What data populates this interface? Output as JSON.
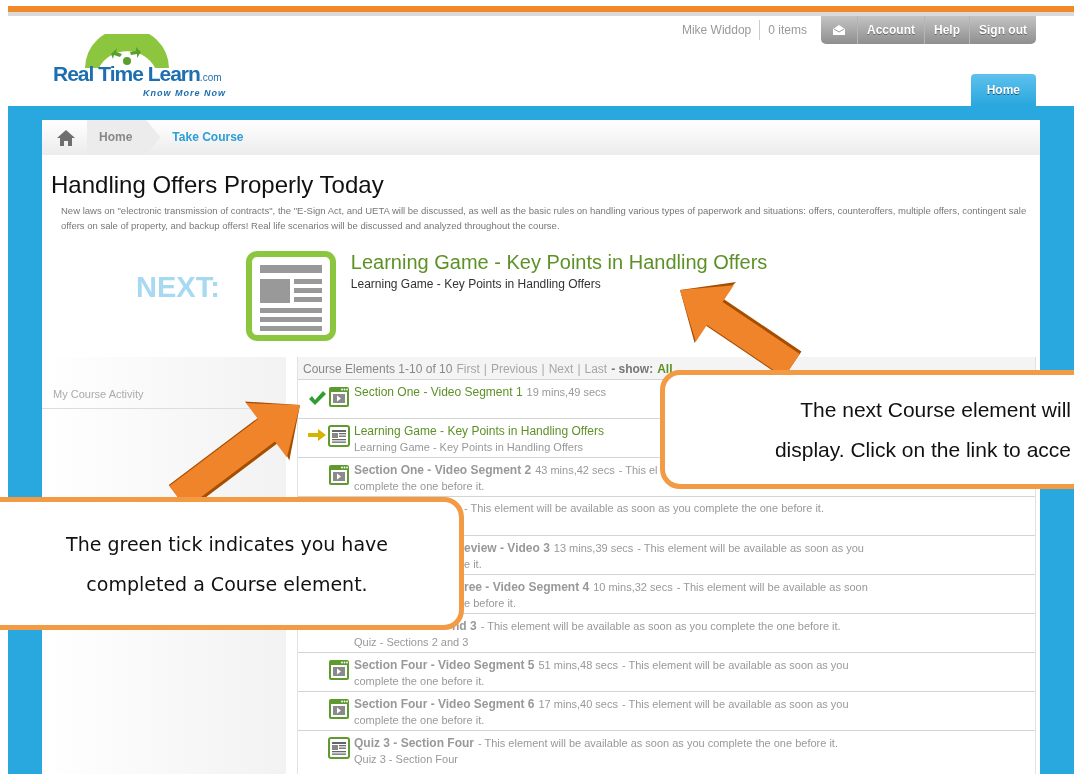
{
  "logo": {
    "name": "Real Time Learn",
    "suffix": ".com",
    "tagline": "Know More Now"
  },
  "user": {
    "name": "Mike Widdop",
    "cart": "0 items"
  },
  "account_menu": [
    "Account",
    "Help",
    "Sign out"
  ],
  "nav_tabs": [
    {
      "label": "Home",
      "selected": true
    }
  ],
  "breadcrumb": [
    "Home",
    "Take Course"
  ],
  "course": {
    "title": "Handling Offers Properly Today",
    "description": "New laws on \"electronic transmission of contracts\", the \"E-Sign Act, and UETA will be discussed, as well as the basic rules on handling various types of paperwork and situations: offers, counteroffers, multiple offers, contingent sale offers on sale of property, and backup offers! Real life scenarios will be discussed and analyzed throughout the course."
  },
  "next": {
    "label": "NEXT:",
    "title": "Learning Game - Key Points in Handling Offers",
    "subtitle": "Learning Game - Key Points in Handling Offers"
  },
  "sidebar": {
    "title": "My Course Activity"
  },
  "elements": {
    "summary": "Course Elements 1-10 of 10",
    "separator": "|",
    "pager": [
      {
        "label": "First",
        "disabled": true
      },
      {
        "label": "Previous",
        "disabled": true
      },
      {
        "label": "Next",
        "disabled": true
      },
      {
        "label": "Last",
        "disabled": true
      }
    ],
    "show_label": "- show:",
    "show_value": "All",
    "rows": [
      {
        "kind": "video",
        "completed": true,
        "current": false,
        "title": "Section One - Video Segment 1",
        "duration": "19 mins,49 secs"
      },
      {
        "kind": "document",
        "completed": false,
        "current": true,
        "title": "Learning Game - Key Points in Handling Offers",
        "line2": "Learning Game - Key Points in Handling Offers"
      },
      {
        "kind": "video",
        "completed": false,
        "current": false,
        "title": "Section One - Video Segment 2",
        "duration": "43 mins,42 secs",
        "note": "- This el",
        "line2": "complete the one before it."
      },
      {
        "kind": "covered",
        "note": "- This element will be available as soon as you complete the one before it."
      },
      {
        "kind": "covered",
        "title": "eview - Video 3",
        "duration": "13 mins,39 secs",
        "note": "- This element will be available as soon as you",
        "line2": "e it."
      },
      {
        "kind": "covered",
        "title": "ree - Video Segment 4",
        "duration": "10 mins,32 secs",
        "note": "- This element will be available as soon",
        "line2": "e before it."
      },
      {
        "kind": "covered-top",
        "title": "nd 3",
        "note": "- This element will be available as soon as you complete the one before it.",
        "line2": "Quiz - Sections 2 and 3"
      },
      {
        "kind": "video",
        "completed": false,
        "current": false,
        "title": "Section Four - Video Segment 5",
        "duration": "51 mins,48 secs",
        "note": "- This element will be available as soon as you",
        "line2": "complete the one before it."
      },
      {
        "kind": "video",
        "completed": false,
        "current": false,
        "title": "Section Four - Video Segment 6",
        "duration": "17 mins,40 secs",
        "note": "- This element will be available as soon as you",
        "line2": "complete the one before it."
      },
      {
        "kind": "document",
        "completed": false,
        "current": false,
        "title": "Quiz 3 - Section Four",
        "note": "- This element will be available as soon as you complete the one before it.",
        "line2": "Quiz 3 - Section Four"
      }
    ]
  },
  "callouts": [
    {
      "lines": [
        "The green tick indicates you have",
        "completed a Course element."
      ]
    },
    {
      "lines": [
        "The next Course element will",
        "display. Click on the link to acce"
      ]
    }
  ]
}
